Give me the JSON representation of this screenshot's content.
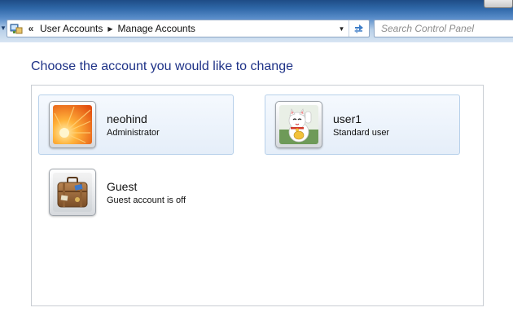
{
  "address_bar": {
    "overflow_chevron": "«",
    "breadcrumbs": [
      "User Accounts",
      "Manage Accounts"
    ],
    "icons": {
      "location": "control-panel-icon",
      "separator": "chevron-right-icon",
      "dropdown": "chevron-down-icon",
      "refresh": "refresh-icon"
    }
  },
  "search": {
    "placeholder": "Search Control Panel"
  },
  "main": {
    "heading": "Choose the account you would like to change",
    "accounts": [
      {
        "name": "neohind",
        "type": "Administrator",
        "picture": "orange-flower-avatar",
        "highlighted": true
      },
      {
        "name": "user1",
        "type": "Standard user",
        "picture": "lucky-cat-avatar",
        "highlighted": true
      },
      {
        "name": "Guest",
        "type": "Guest account is off",
        "picture": "suitcase-avatar",
        "highlighted": false
      }
    ]
  },
  "colors": {
    "heading": "#1e3287",
    "tile_border": "#b7d0ea",
    "tile_fill": "#e5eef9",
    "panel_border": "#c9cdd3"
  }
}
